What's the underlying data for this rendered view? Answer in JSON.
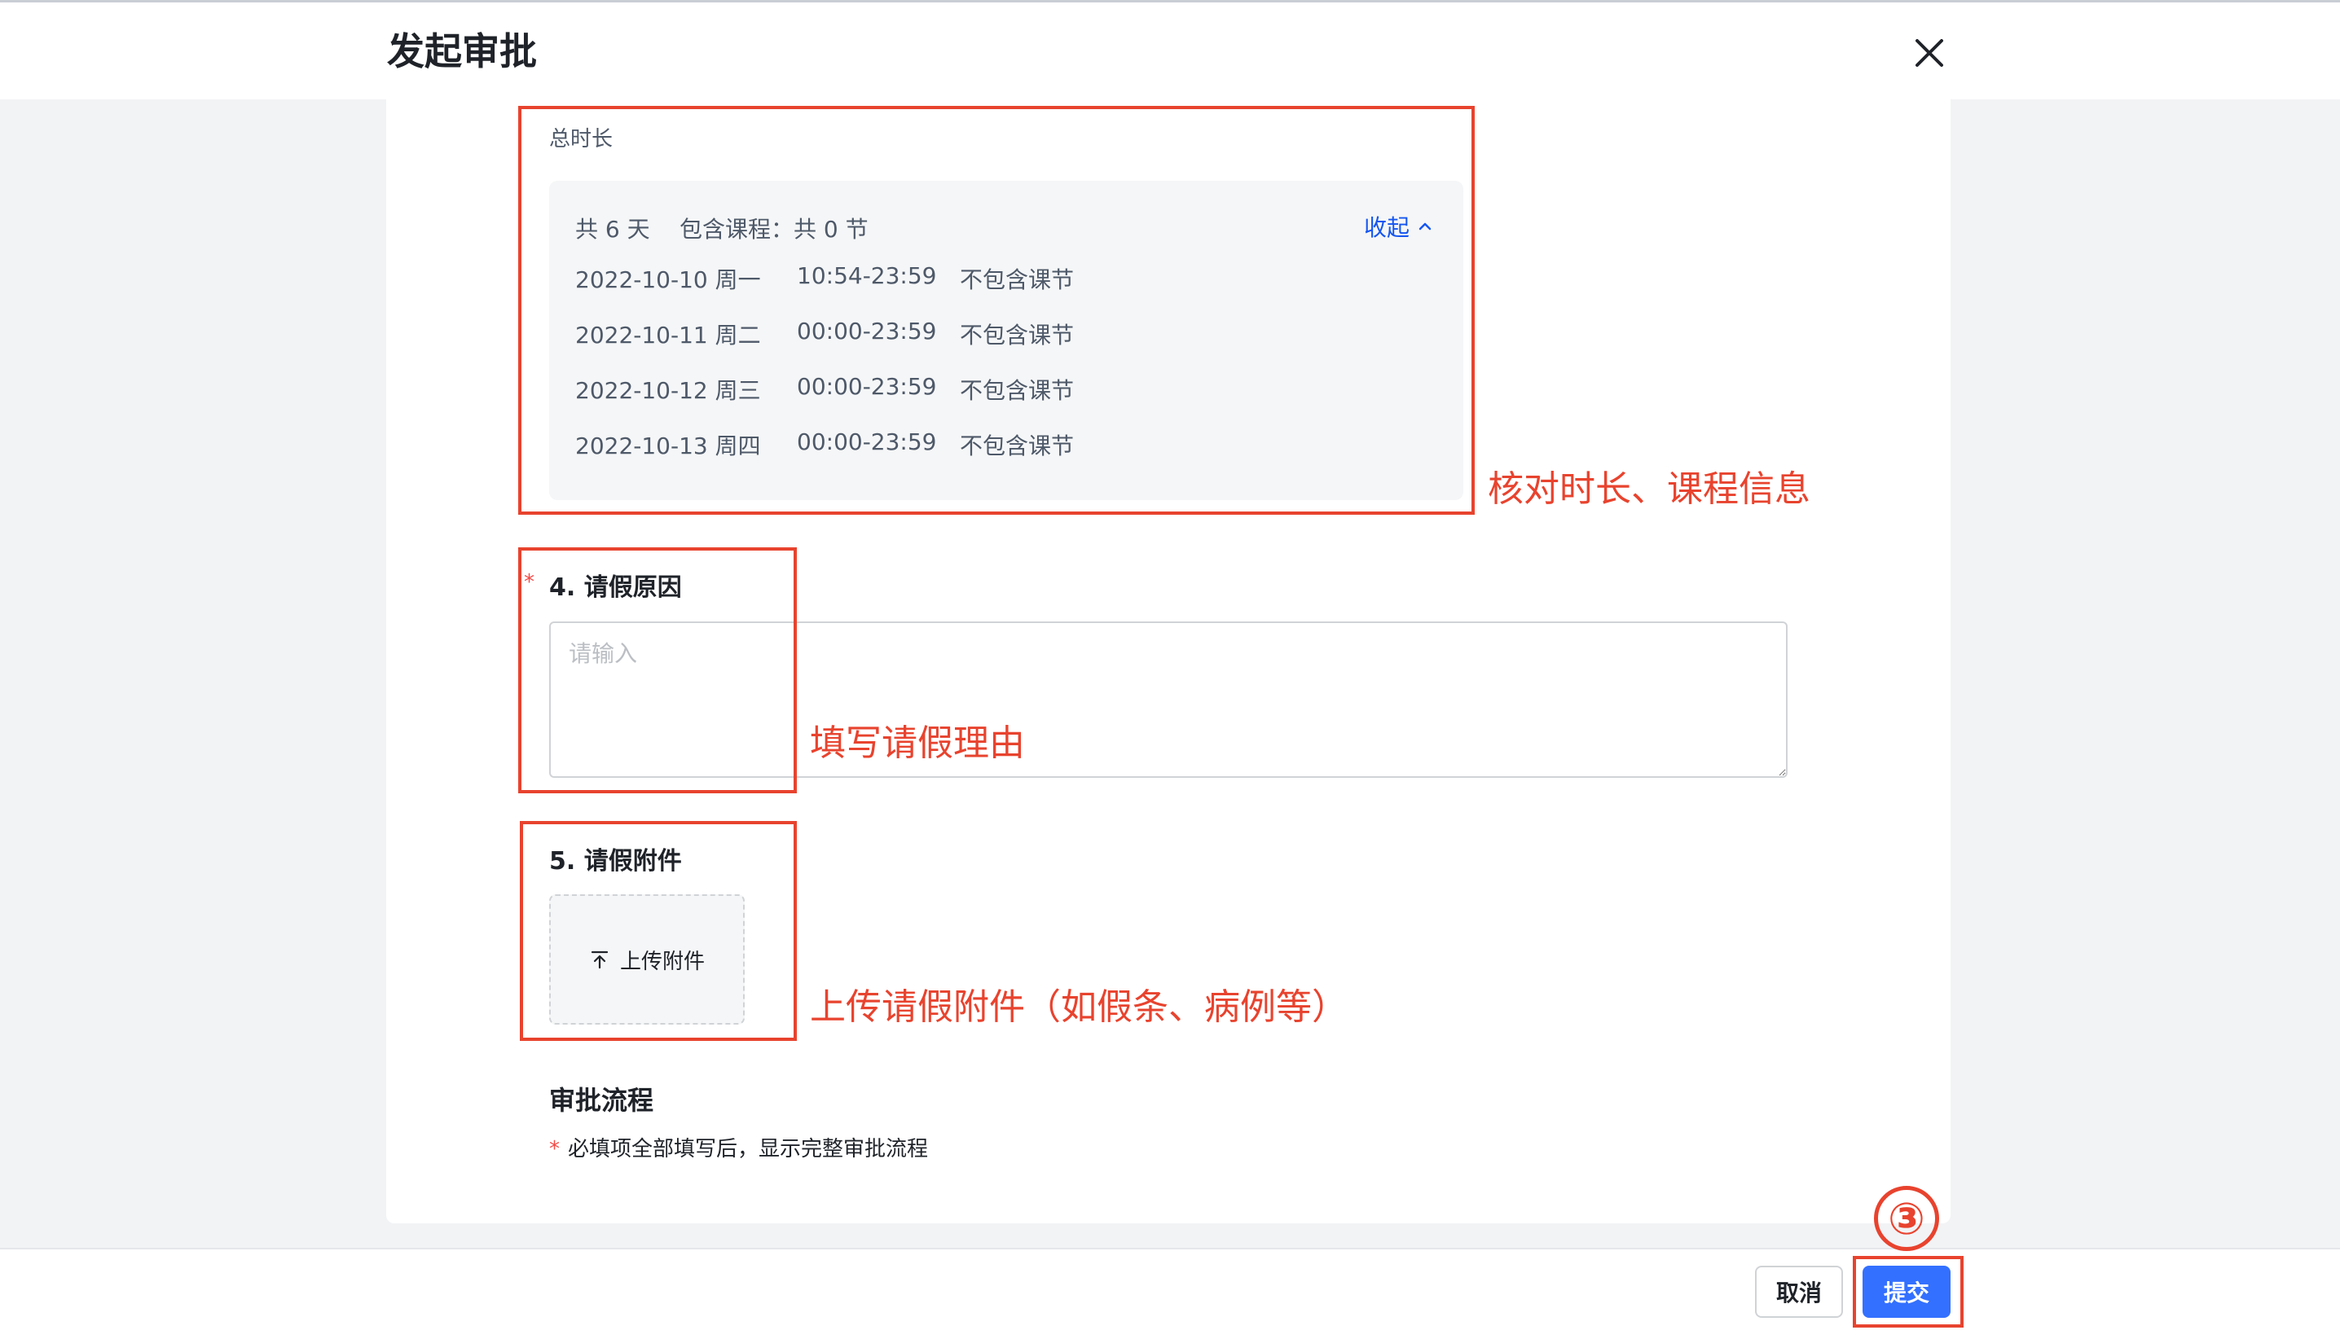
{
  "dialog": {
    "title": "发起审批"
  },
  "duration": {
    "label": "总时长",
    "summary_days": "共 6 天",
    "summary_courses": "包含课程：共 0 节",
    "collapse_label": "收起",
    "rows": [
      {
        "date": "2022-10-10 周一",
        "time": "10:54-23:59",
        "course": "不包含课节"
      },
      {
        "date": "2022-10-11 周二",
        "time": "00:00-23:59",
        "course": "不包含课节"
      },
      {
        "date": "2022-10-12 周三",
        "time": "00:00-23:59",
        "course": "不包含课节"
      },
      {
        "date": "2022-10-13 周四",
        "time": "00:00-23:59",
        "course": "不包含课节"
      }
    ]
  },
  "reason": {
    "required_mark": "*",
    "title": "4. 请假原因",
    "placeholder": "请输入",
    "value": ""
  },
  "attachment": {
    "title": "5. 请假附件",
    "upload_label": "上传附件"
  },
  "approval_flow": {
    "title": "审批流程",
    "note_star": "*",
    "note": "必填项全部填写后，显示完整审批流程"
  },
  "footer": {
    "cancel_label": "取消",
    "submit_label": "提交"
  },
  "annotations": {
    "duration_note": "核对时长、课程信息",
    "reason_note": "填写请假理由",
    "attachment_note": "上传请假附件（如假条、病例等）",
    "step_number": "③",
    "color": "#e8432e"
  },
  "colors": {
    "primary": "#3370ff",
    "link": "#1456f0",
    "required": "#f54a45"
  },
  "icons": [
    "close-icon",
    "chevron-up-icon",
    "upload-icon"
  ]
}
